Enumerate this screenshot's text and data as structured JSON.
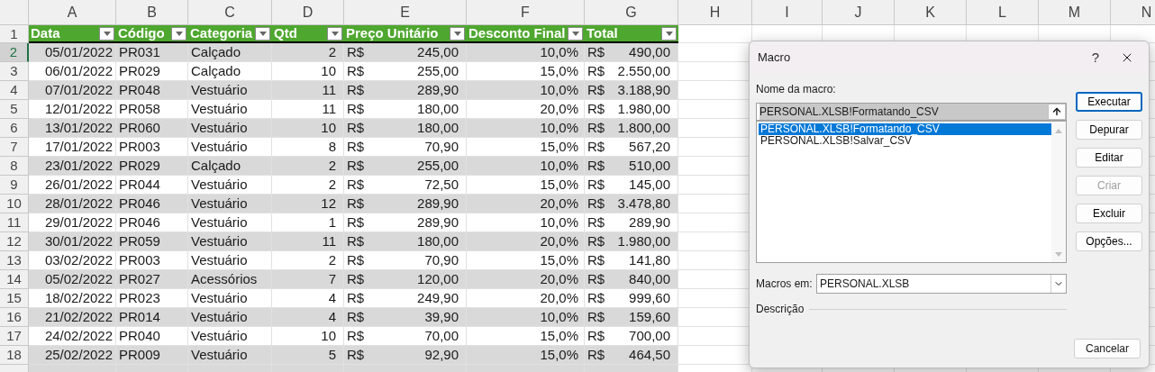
{
  "columns": [
    {
      "letter": "A",
      "selected": false
    },
    {
      "letter": "B",
      "selected": false
    },
    {
      "letter": "C",
      "selected": false
    },
    {
      "letter": "D",
      "selected": false
    },
    {
      "letter": "E",
      "selected": false
    },
    {
      "letter": "F",
      "selected": false
    },
    {
      "letter": "G",
      "selected": false
    },
    {
      "letter": "H",
      "selected": false
    },
    {
      "letter": "I",
      "selected": false
    },
    {
      "letter": "J",
      "selected": false
    },
    {
      "letter": "K",
      "selected": false
    },
    {
      "letter": "L",
      "selected": false
    },
    {
      "letter": "M",
      "selected": false
    },
    {
      "letter": "N",
      "selected": false
    }
  ],
  "table": {
    "header_row": "1",
    "headers": [
      "Data",
      "Código",
      "Categoria",
      "Qtd",
      "Preço Unitário",
      "Desconto Final",
      "Total"
    ],
    "rows": [
      {
        "row": "2",
        "selected": true,
        "data": "05/01/2022",
        "codigo": "PR031",
        "categoria": "Calçado",
        "qtd": "2",
        "preco": {
          "currency": "R$",
          "amount": "245,00"
        },
        "desconto": "10,0%",
        "total": {
          "currency": "R$",
          "amount": "490,00"
        }
      },
      {
        "row": "3",
        "selected": false,
        "data": "06/01/2022",
        "codigo": "PR029",
        "categoria": "Calçado",
        "qtd": "10",
        "preco": {
          "currency": "R$",
          "amount": "255,00"
        },
        "desconto": "15,0%",
        "total": {
          "currency": "R$",
          "amount": "2.550,00"
        }
      },
      {
        "row": "4",
        "selected": false,
        "data": "07/01/2022",
        "codigo": "PR048",
        "categoria": "Vestuário",
        "qtd": "11",
        "preco": {
          "currency": "R$",
          "amount": "289,90"
        },
        "desconto": "10,0%",
        "total": {
          "currency": "R$",
          "amount": "3.188,90"
        }
      },
      {
        "row": "5",
        "selected": false,
        "data": "12/01/2022",
        "codigo": "PR058",
        "categoria": "Vestuário",
        "qtd": "11",
        "preco": {
          "currency": "R$",
          "amount": "180,00"
        },
        "desconto": "20,0%",
        "total": {
          "currency": "R$",
          "amount": "1.980,00"
        }
      },
      {
        "row": "6",
        "selected": false,
        "data": "13/01/2022",
        "codigo": "PR060",
        "categoria": "Vestuário",
        "qtd": "10",
        "preco": {
          "currency": "R$",
          "amount": "180,00"
        },
        "desconto": "10,0%",
        "total": {
          "currency": "R$",
          "amount": "1.800,00"
        }
      },
      {
        "row": "7",
        "selected": false,
        "data": "17/01/2022",
        "codigo": "PR003",
        "categoria": "Vestuário",
        "qtd": "8",
        "preco": {
          "currency": "R$",
          "amount": "70,90"
        },
        "desconto": "15,0%",
        "total": {
          "currency": "R$",
          "amount": "567,20"
        }
      },
      {
        "row": "8",
        "selected": false,
        "data": "23/01/2022",
        "codigo": "PR029",
        "categoria": "Calçado",
        "qtd": "2",
        "preco": {
          "currency": "R$",
          "amount": "255,00"
        },
        "desconto": "10,0%",
        "total": {
          "currency": "R$",
          "amount": "510,00"
        }
      },
      {
        "row": "9",
        "selected": false,
        "data": "26/01/2022",
        "codigo": "PR044",
        "categoria": "Vestuário",
        "qtd": "2",
        "preco": {
          "currency": "R$",
          "amount": "72,50"
        },
        "desconto": "15,0%",
        "total": {
          "currency": "R$",
          "amount": "145,00"
        }
      },
      {
        "row": "10",
        "selected": false,
        "data": "28/01/2022",
        "codigo": "PR046",
        "categoria": "Vestuário",
        "qtd": "12",
        "preco": {
          "currency": "R$",
          "amount": "289,90"
        },
        "desconto": "20,0%",
        "total": {
          "currency": "R$",
          "amount": "3.478,80"
        }
      },
      {
        "row": "11",
        "selected": false,
        "data": "29/01/2022",
        "codigo": "PR046",
        "categoria": "Vestuário",
        "qtd": "1",
        "preco": {
          "currency": "R$",
          "amount": "289,90"
        },
        "desconto": "10,0%",
        "total": {
          "currency": "R$",
          "amount": "289,90"
        }
      },
      {
        "row": "12",
        "selected": false,
        "data": "30/01/2022",
        "codigo": "PR059",
        "categoria": "Vestuário",
        "qtd": "11",
        "preco": {
          "currency": "R$",
          "amount": "180,00"
        },
        "desconto": "20,0%",
        "total": {
          "currency": "R$",
          "amount": "1.980,00"
        }
      },
      {
        "row": "13",
        "selected": false,
        "data": "03/02/2022",
        "codigo": "PR003",
        "categoria": "Vestuário",
        "qtd": "2",
        "preco": {
          "currency": "R$",
          "amount": "70,90"
        },
        "desconto": "15,0%",
        "total": {
          "currency": "R$",
          "amount": "141,80"
        }
      },
      {
        "row": "14",
        "selected": false,
        "data": "05/02/2022",
        "codigo": "PR027",
        "categoria": "Acessórios",
        "qtd": "7",
        "preco": {
          "currency": "R$",
          "amount": "120,00"
        },
        "desconto": "20,0%",
        "total": {
          "currency": "R$",
          "amount": "840,00"
        }
      },
      {
        "row": "15",
        "selected": false,
        "data": "18/02/2022",
        "codigo": "PR023",
        "categoria": "Vestuário",
        "qtd": "4",
        "preco": {
          "currency": "R$",
          "amount": "249,90"
        },
        "desconto": "20,0%",
        "total": {
          "currency": "R$",
          "amount": "999,60"
        }
      },
      {
        "row": "16",
        "selected": false,
        "data": "21/02/2022",
        "codigo": "PR014",
        "categoria": "Vestuário",
        "qtd": "4",
        "preco": {
          "currency": "R$",
          "amount": "39,90"
        },
        "desconto": "10,0%",
        "total": {
          "currency": "R$",
          "amount": "159,60"
        }
      },
      {
        "row": "17",
        "selected": false,
        "data": "24/02/2022",
        "codigo": "PR040",
        "categoria": "Vestuário",
        "qtd": "10",
        "preco": {
          "currency": "R$",
          "amount": "70,00"
        },
        "desconto": "15,0%",
        "total": {
          "currency": "R$",
          "amount": "700,00"
        }
      },
      {
        "row": "18",
        "selected": false,
        "data": "25/02/2022",
        "codigo": "PR009",
        "categoria": "Vestuário",
        "qtd": "5",
        "preco": {
          "currency": "R$",
          "amount": "92,90"
        },
        "desconto": "15,0%",
        "total": {
          "currency": "R$",
          "amount": "464,50"
        }
      }
    ]
  },
  "dialog": {
    "title": "Macro",
    "help": "?",
    "name_label": "Nome da macro:",
    "name_value": "PERSONAL.XLSB!Formatando_CSV",
    "macros": [
      {
        "label": "PERSONAL.XLSB!Formatando_CSV",
        "selected": true
      },
      {
        "label": "PERSONAL.XLSB!Salvar_CSV",
        "selected": false
      }
    ],
    "buttons": [
      {
        "label": "Executar",
        "default": true,
        "disabled": false
      },
      {
        "label": "Depurar",
        "default": false,
        "disabled": false
      },
      {
        "label": "Editar",
        "default": false,
        "disabled": false
      },
      {
        "label": "Criar",
        "default": false,
        "disabled": true
      },
      {
        "label": "Excluir",
        "default": false,
        "disabled": false
      },
      {
        "label": "Opções...",
        "default": false,
        "disabled": false
      }
    ],
    "macros_in_label": "Macros em:",
    "macros_in_value": "PERSONAL.XLSB",
    "description_label": "Descrição",
    "cancel": "Cancelar"
  }
}
